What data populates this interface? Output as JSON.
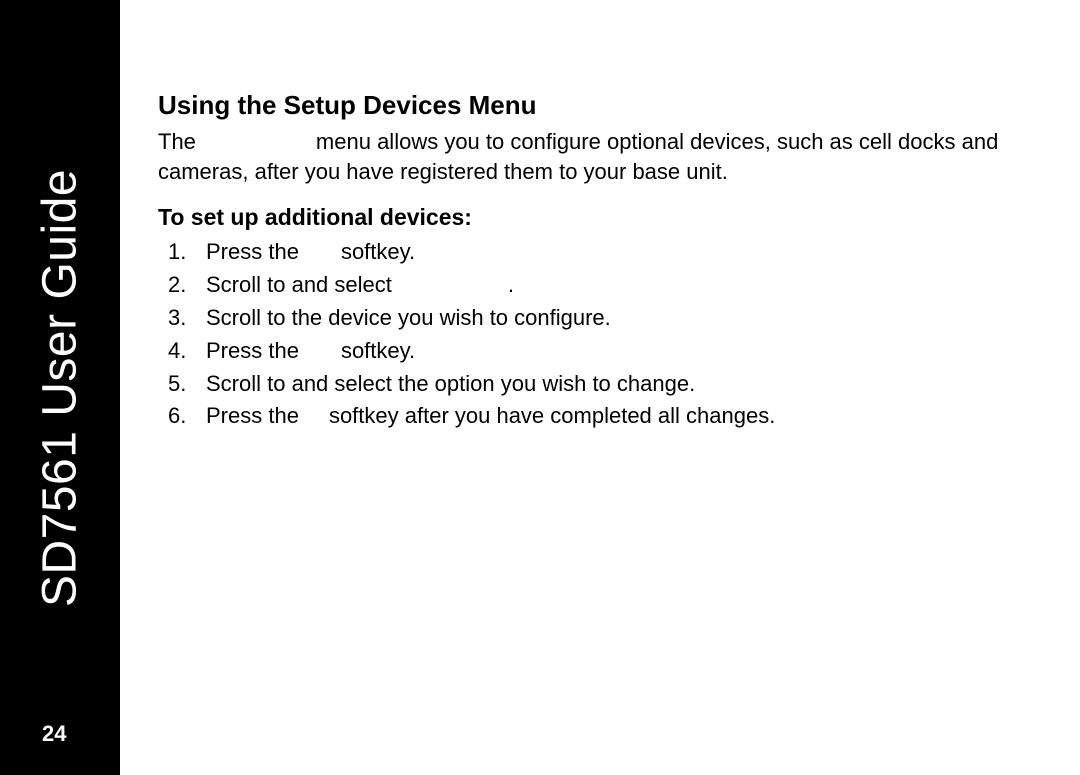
{
  "sidebar": {
    "title": "SD7561 User Guide",
    "page_number": "24"
  },
  "content": {
    "heading": "Using the Setup Devices Menu",
    "para_pre": "The",
    "para_post": "menu allows you to configure optional devices, such as cell docks and cameras, after you have registered them to your base unit.",
    "subheading": "To set up additional devices:",
    "steps": [
      {
        "num": "1.",
        "pre": "Press the",
        "post": "softkey."
      },
      {
        "num": "2.",
        "pre": "Scroll to and select",
        "post": "."
      },
      {
        "num": "3.",
        "pre": "Scroll to the device you wish to configure.",
        "post": ""
      },
      {
        "num": "4.",
        "pre": "Press the",
        "post": "softkey."
      },
      {
        "num": "5.",
        "pre": "Scroll to and select the option you wish to change.",
        "post": ""
      },
      {
        "num": "6.",
        "pre": "Press the",
        "post": "softkey after you have completed all changes."
      }
    ]
  }
}
